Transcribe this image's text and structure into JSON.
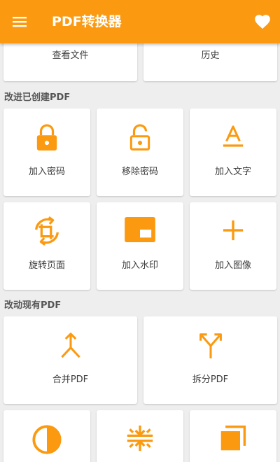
{
  "colors": {
    "accent": "#fb9a10",
    "appbar_text": "#ffffff",
    "background": "#eeeeee"
  },
  "appbar": {
    "title": "PDF转换器",
    "menu_icon": "menu-icon",
    "favorite_icon": "heart-icon"
  },
  "top_row": [
    {
      "label": "查看文件"
    },
    {
      "label": "历史"
    }
  ],
  "section_improve": {
    "title": "改进已创建PDF",
    "items": [
      {
        "label": "加入密码",
        "icon": "lock-icon"
      },
      {
        "label": "移除密码",
        "icon": "unlock-icon"
      },
      {
        "label": "加入文字",
        "icon": "text-icon"
      },
      {
        "label": "旋转页面",
        "icon": "rotate-icon"
      },
      {
        "label": "加入水印",
        "icon": "watermark-icon"
      },
      {
        "label": "加入图像",
        "icon": "plus-icon"
      }
    ]
  },
  "section_modify": {
    "title": "改动现有PDF",
    "items": [
      {
        "label": "合并PDF",
        "icon": "merge-icon"
      },
      {
        "label": "拆分PDF",
        "icon": "split-icon"
      }
    ],
    "bottom_icons": [
      "contrast-icon",
      "compress-icon",
      "copy-icon"
    ]
  }
}
